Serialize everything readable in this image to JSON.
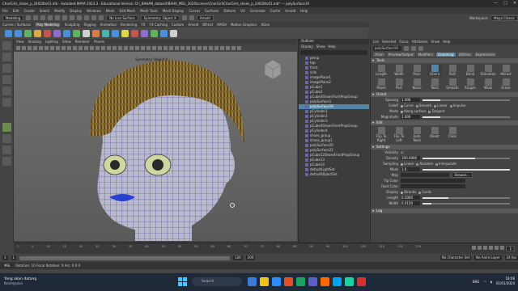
{
  "titlebar": {
    "title": "CharGirls_shoes_p_24020tv01.mb - Autodesk MAYA 2023.3 - Educational Version: D:\\_BAHAN_dataset\\BAHU_MDL_2024\\scenes\\CharGirl\\CharGirls_shoes_p_24020tv01.mb* --- polySurface19",
    "controls": [
      "—",
      "□",
      "✕"
    ]
  },
  "menubar": {
    "items": [
      "File",
      "Edit",
      "Create",
      "Select",
      "Modify",
      "Display",
      "Windows",
      "Mesh",
      "Edit Mesh",
      "Mesh Tools",
      "Mesh Display",
      "Curves",
      "Surfaces",
      "Deform",
      "UV",
      "Generate",
      "Cache",
      "Arnold",
      "Help"
    ],
    "workspace_label": "Workspace:",
    "workspace_value": "Maya Classic"
  },
  "statusline": {
    "mode": "Modeling",
    "live_surface": "No Live Surface",
    "symmetry": "Symmetry: Object X",
    "renderer": "Arnold"
  },
  "shelf": {
    "tabs": [
      "Curves / Surfaces",
      "Poly Modeling",
      "Sculpting",
      "Rigging",
      "Animation",
      "Rendering",
      "FX",
      "FX Caching",
      "Custom",
      "Arnold",
      "Bifrost",
      "MASH",
      "Motion Graphics",
      "XGen"
    ],
    "active_tab": "Poly Modeling",
    "icon_colors": [
      "#4a90d9",
      "#4a90d9",
      "#5fb35f",
      "#d9a94a",
      "#c45555",
      "#8a6fd1",
      "#4a90d9",
      "#5fb35f",
      "#cfcfcf",
      "#d97a4a",
      "#4ab3b3",
      "#4a90d9",
      "#d9d94a",
      "#c45555",
      "#8a6fd1",
      "#5fb35f",
      "#4a90d9",
      "#cfcfcf"
    ]
  },
  "viewport": {
    "menu": [
      "View",
      "Shading",
      "Lighting",
      "Show",
      "Renderer",
      "Panels"
    ],
    "symmetry_label": "Symmetry: Object X"
  },
  "outliner": {
    "title": "Outliner",
    "menu": [
      "Display",
      "Show",
      "Help"
    ],
    "rows": [
      {
        "label": "persp",
        "selected": false
      },
      {
        "label": "top",
        "selected": false
      },
      {
        "label": "front",
        "selected": false
      },
      {
        "label": "side",
        "selected": false
      },
      {
        "label": "imagePlane1",
        "selected": false
      },
      {
        "label": "imagePlane2",
        "selected": false
      },
      {
        "label": "pCube1",
        "selected": false
      },
      {
        "label": "pCube2",
        "selected": false
      },
      {
        "label": "pCube3ShoesFrontPropGroup",
        "selected": false
      },
      {
        "label": "polySurface1",
        "selected": false
      },
      {
        "label": "polySurface19",
        "selected": true
      },
      {
        "label": "pCylinder1",
        "selected": false
      },
      {
        "label": "pCylinder2",
        "selected": false
      },
      {
        "label": "pCylinder3",
        "selected": false
      },
      {
        "label": "pCube4ShoesFrontPropGroup",
        "selected": false
      },
      {
        "label": "pCylinder4",
        "selected": false
      },
      {
        "label": "shoes_group",
        "selected": false
      },
      {
        "label": "shoes_group1",
        "selected": false
      },
      {
        "label": "polySurface20",
        "selected": false
      },
      {
        "label": "polySurface21",
        "selected": false
      },
      {
        "label": "pCube12ShoesFrontPropGroup",
        "selected": false
      },
      {
        "label": "pCube13",
        "selected": false
      },
      {
        "label": "pCube14",
        "selected": false
      },
      {
        "label": "defaultLightSet",
        "selected": false
      },
      {
        "label": "defaultObjectSet",
        "selected": false
      }
    ]
  },
  "attribute_editor": {
    "tabs": [
      "List",
      "Selected",
      "Focus",
      "Attributes",
      "Show",
      "Help"
    ],
    "node_name": "polySurface19",
    "node_tabs": [
      "XGen",
      "Preview/Output",
      "Modifiers",
      "Grooming",
      "Utilities",
      "Expressions"
    ],
    "active_node_tab": "Grooming",
    "tools_section": "Tools",
    "tools": [
      "Length",
      "Width",
      "Pose",
      "Orient",
      "Part",
      "Bend",
      "Elevation",
      "Attract",
      "Repel",
      "Part",
      "Noise",
      "Twist",
      "Smooth",
      "Ringon",
      "Mask",
      "Erase"
    ],
    "active_tool": "Orient",
    "brush_section": "Orient",
    "spacing_label": "Spacing",
    "spacing_value": "1.000",
    "falloff_label": "Falloff",
    "falloff_options": [
      "Curve",
      "Smooth",
      "Linear",
      "Impulse"
    ],
    "mode_label": "Mode",
    "mode_options": [
      "Along surface",
      "Tangent"
    ],
    "magnitude_label": "Magnitude",
    "magnitude_value": "1.000",
    "edit_section": "Edit",
    "edit_tools": [
      "Flip To Right",
      "Flip To Left",
      "Auto Twist",
      "Reset",
      "Clear"
    ],
    "settings_section": "Settings",
    "visibility_label": "Visibility",
    "density_label": "Density",
    "density_value": "100.0000",
    "sampling_label": "Sampling",
    "sampling_options": [
      "Linear",
      "Random",
      "Interpolate"
    ],
    "mask_label": "Mask",
    "mask_value": "1.0",
    "map_label": "Map",
    "browse_label": "Browse...",
    "tip_color_label": "Tip Color",
    "root_color_label": "Root Color",
    "display_label": "Display",
    "display_options": [
      "Strands",
      "Cards"
    ],
    "length_label": "Length",
    "length_value": "0.5000",
    "width_label": "Width",
    "width_value": "0.0150",
    "log_section": "Log"
  },
  "timeline": {
    "ticks": [
      "1",
      "5",
      "10",
      "15",
      "20",
      "25",
      "30",
      "35",
      "40",
      "45",
      "50",
      "55",
      "60",
      "65",
      "70",
      "75",
      "80",
      "85",
      "90",
      "95",
      "100",
      "105",
      "110",
      "115",
      "120"
    ],
    "current_frame": "1",
    "range_start": "1",
    "range_inner_start": "1",
    "range_inner_end": "120",
    "range_end": "200",
    "character_set": "No Character Set",
    "anim_layer": "No Anim Layer",
    "fps": "24 fps"
  },
  "cmdline": {
    "mel_label": "MEL",
    "help_text": "Rotation: 10 Focal Rotation: 0 Arc: 0 0 0"
  },
  "taskbar": {
    "weather_line1": "Yang akan datang",
    "weather_line2": "Kesimpulan",
    "search_placeholder": "Search",
    "app_colors": [
      "#3a7bd5",
      "#f0c419",
      "#2d8cff",
      "#e34f26",
      "#1aa260",
      "#5b5fc7",
      "#ff6a00",
      "#00a4ef",
      "#1dd1a1",
      "#d63031"
    ],
    "time": "18:08",
    "date": "01/01/2024",
    "language": "ENG"
  }
}
